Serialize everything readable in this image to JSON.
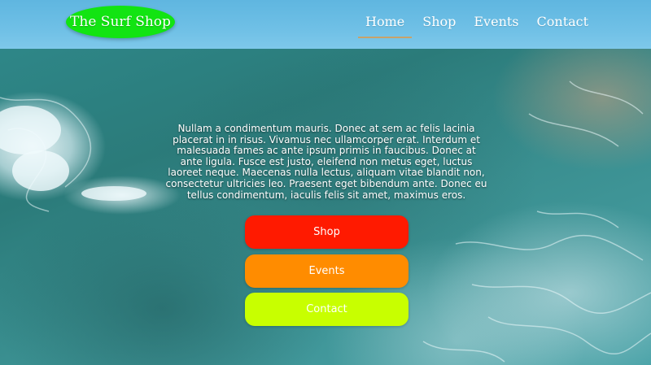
{
  "header": {
    "logo_text": "The Surf Shop",
    "nav": [
      {
        "label": "Home",
        "active": true
      },
      {
        "label": "Shop",
        "active": false
      },
      {
        "label": "Events",
        "active": false
      },
      {
        "label": "Contact",
        "active": false
      }
    ]
  },
  "main": {
    "intro_text": "Nullam a condimentum mauris. Donec at sem ac felis lacinia placerat in in risus. Vivamus nec ullamcorper erat. Interdum et malesuada fames ac ante ipsum primis in faucibus. Donec at ante ligula. Fusce est justo, eleifend non metus eget, luctus laoreet neque. Maecenas nulla lectus, aliquam vitae blandit non, consectetur ultricies leo. Praesent eget bibendum ante. Donec eu tellus condimentum, iaculis felis sit amet, maximus eros.",
    "buttons": [
      {
        "label": "Shop",
        "color": "#ff1a00"
      },
      {
        "label": "Events",
        "color": "#ff8c00"
      },
      {
        "label": "Contact",
        "color": "#c8ff00"
      }
    ]
  },
  "colors": {
    "header_bg": "#6fc0e6",
    "logo_bg": "#12e412",
    "nav_active_underline": "#c8a26a"
  }
}
